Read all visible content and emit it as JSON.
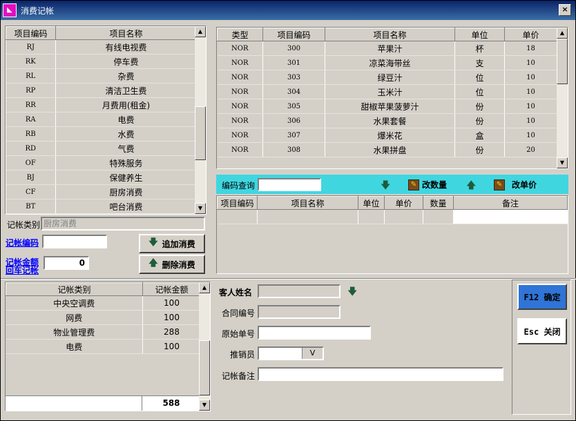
{
  "window": {
    "title": "消费记帐",
    "close": "×"
  },
  "items_table": {
    "headers": [
      "项目编码",
      "项目名称"
    ],
    "rows": [
      [
        "RJ",
        "有线电视费"
      ],
      [
        "RK",
        "停车费"
      ],
      [
        "RL",
        "杂费"
      ],
      [
        "RP",
        "清洁卫生费"
      ],
      [
        "RR",
        "月费用(租金)"
      ],
      [
        "RA",
        "电费"
      ],
      [
        "RB",
        "水费"
      ],
      [
        "RD",
        "气费"
      ],
      [
        "OF",
        "特殊服务"
      ],
      [
        "BJ",
        "保健养生"
      ],
      [
        "CF",
        "厨房消费"
      ],
      [
        "BT",
        "吧台消费"
      ]
    ]
  },
  "left_form": {
    "category_label": "记帐类别",
    "category_value": "厨房消费",
    "code_label": "记帐编码",
    "code_value": "",
    "amount_label": "记帐金额",
    "car_label": "回车记帐",
    "amount_value": "0",
    "add_label": "追加消费",
    "delete_label": "删除消费"
  },
  "goods_table": {
    "headers": [
      "类型",
      "项目编码",
      "项目名称",
      "单位",
      "单价"
    ],
    "rows": [
      [
        "NOR",
        "300",
        "苹果汁",
        "杯",
        "18"
      ],
      [
        "NOR",
        "301",
        "凉菜海带丝",
        "支",
        "10"
      ],
      [
        "NOR",
        "303",
        "绿豆汁",
        "位",
        "10"
      ],
      [
        "NOR",
        "304",
        "玉米汁",
        "位",
        "10"
      ],
      [
        "NOR",
        "305",
        "甜椒苹果菠萝汁",
        "份",
        "10"
      ],
      [
        "NOR",
        "306",
        "水果套餐",
        "份",
        "10"
      ],
      [
        "NOR",
        "307",
        "爆米花",
        "盒",
        "10"
      ],
      [
        "NOR",
        "308",
        "水果拼盘",
        "份",
        "20"
      ]
    ]
  },
  "toolbar": {
    "search_label": "编码查询",
    "search_value": "",
    "change_qty_label": "改数量",
    "change_price_label": "改单价"
  },
  "order_table": {
    "headers": [
      "项目编码",
      "项目名称",
      "单位",
      "单价",
      "数量",
      "备注"
    ]
  },
  "summary_table": {
    "headers": [
      "记帐类别",
      "记帐金额"
    ],
    "rows": [
      [
        "中央空调费",
        "100"
      ],
      [
        "网费",
        "100"
      ],
      [
        "物业管理费",
        "288"
      ],
      [
        "电费",
        "100"
      ]
    ],
    "total": "588"
  },
  "guest_form": {
    "name_label": "客人姓名",
    "contract_label": "合同编号",
    "orig_label": "原始单号",
    "sales_label": "推销员",
    "note_label": "记帐备注",
    "dropdown_arrow": "V"
  },
  "actions": {
    "confirm_label": "F12 确定",
    "close_label": "Esc 关闭"
  },
  "colors": {
    "title_start": "#0a246a",
    "title_end": "#3a6ea5",
    "toolbar_bg": "#40d6e0",
    "link": "#0000ff",
    "confirm_bg": "#2f74d6"
  }
}
